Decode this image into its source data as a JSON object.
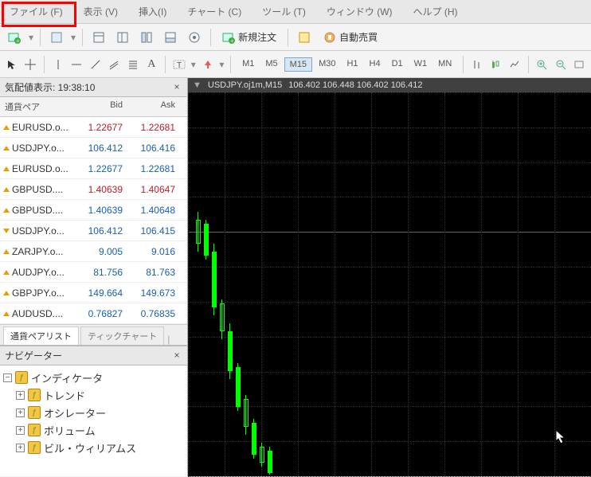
{
  "menu": {
    "file": "ファイル (F)",
    "view": "表示 (V)",
    "insert": "挿入(I)",
    "chart": "チャート (C)",
    "tools": "ツール (T)",
    "window": "ウィンドウ (W)",
    "help": "ヘルプ (H)"
  },
  "toolbar": {
    "neworder": "新規注文",
    "autotrade": "自動売買"
  },
  "timeframes": [
    "M1",
    "M5",
    "M15",
    "M30",
    "H1",
    "H4",
    "D1",
    "W1",
    "MN"
  ],
  "active_tf": "M15",
  "marketwatch": {
    "title": "気配値表示: 19:38:10",
    "head_symbol": "通貨ペア",
    "head_bid": "Bid",
    "head_ask": "Ask",
    "rows": [
      {
        "sym": "EURUSD.o...",
        "bid": "1.22677",
        "ask": "1.22681",
        "bidc": "down",
        "askc": "down",
        "dir": "up"
      },
      {
        "sym": "USDJPY.o...",
        "bid": "106.412",
        "ask": "106.416",
        "bidc": "up",
        "askc": "up",
        "dir": "up"
      },
      {
        "sym": "EURUSD.o...",
        "bid": "1.22677",
        "ask": "1.22681",
        "bidc": "up",
        "askc": "up",
        "dir": "up"
      },
      {
        "sym": "GBPUSD....",
        "bid": "1.40639",
        "ask": "1.40647",
        "bidc": "down",
        "askc": "down",
        "dir": "up"
      },
      {
        "sym": "GBPUSD....",
        "bid": "1.40639",
        "ask": "1.40648",
        "bidc": "up",
        "askc": "up",
        "dir": "up"
      },
      {
        "sym": "USDJPY.o...",
        "bid": "106.412",
        "ask": "106.415",
        "bidc": "up",
        "askc": "up",
        "dir": "dn"
      },
      {
        "sym": "ZARJPY.o...",
        "bid": "9.005",
        "ask": "9.016",
        "bidc": "up",
        "askc": "up",
        "dir": "up"
      },
      {
        "sym": "AUDJPY.o...",
        "bid": "81.756",
        "ask": "81.763",
        "bidc": "up",
        "askc": "up",
        "dir": "up"
      },
      {
        "sym": "GBPJPY.o...",
        "bid": "149.664",
        "ask": "149.673",
        "bidc": "up",
        "askc": "up",
        "dir": "up"
      },
      {
        "sym": "AUDUSD....",
        "bid": "0.76827",
        "ask": "0.76835",
        "bidc": "up",
        "askc": "up",
        "dir": "up"
      }
    ],
    "tab_list": "通貨ペアリスト",
    "tab_tick": "ティックチャート"
  },
  "navigator": {
    "title": "ナビゲーター",
    "root": "インディケータ",
    "children": [
      "トレンド",
      "オシレーター",
      "ボリューム",
      "ビル・ウィリアムス"
    ]
  },
  "chart": {
    "title": "USDJPY.oj1m,M15",
    "ohlc": "106.402 106.448 106.402 106.412"
  }
}
